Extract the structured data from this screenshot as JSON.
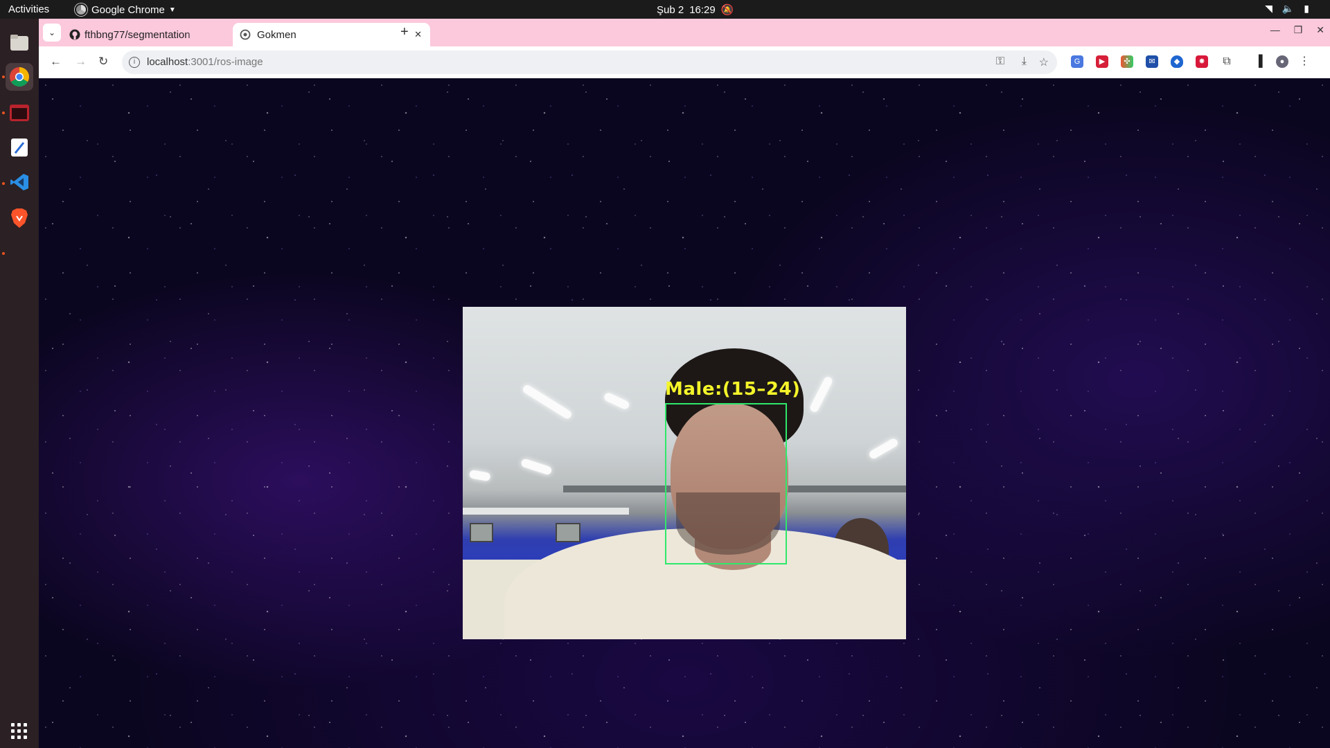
{
  "topbar": {
    "activities": "Activities",
    "app_name": "Google Chrome",
    "date": "Şub 2",
    "time": "16:29"
  },
  "dock": {
    "items": [
      "files-icon",
      "chrome-icon",
      "terminal-icon",
      "text-editor-icon",
      "vscode-icon",
      "brave-icon"
    ]
  },
  "browser": {
    "tabs": [
      {
        "title": "fthbng77/segmentation",
        "active": false
      },
      {
        "title": "Gokmen",
        "active": true
      }
    ],
    "url_host": "localhost",
    "url_path": ":3001/ros-image"
  },
  "detection": {
    "label": "Male:(15–24)"
  },
  "colors": {
    "tabstrip": "#fcc8dc",
    "bbox": "#2ee86a",
    "label": "#f4f42a"
  }
}
